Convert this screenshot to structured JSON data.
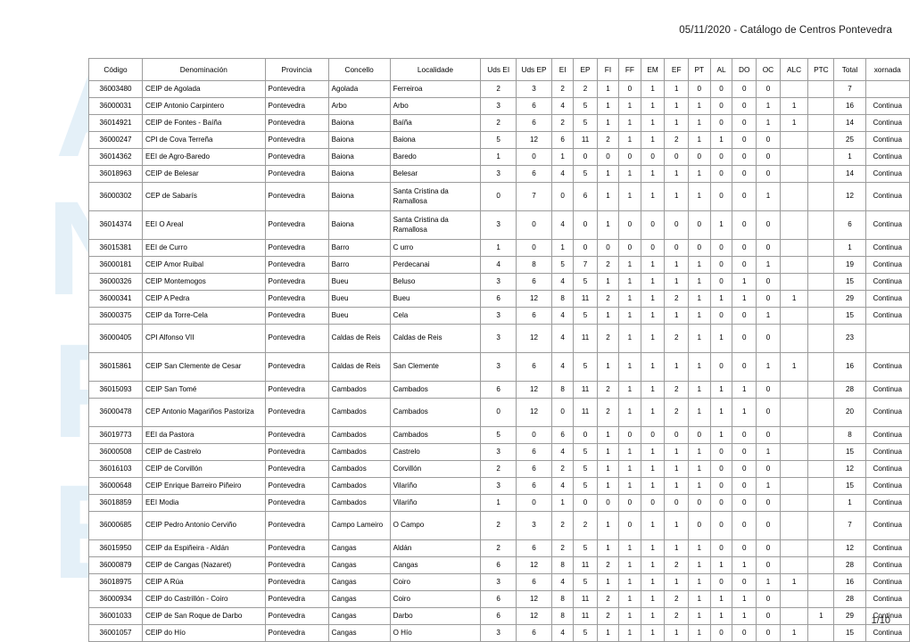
{
  "document": {
    "header": "05/11/2020 - Catálogo de Centros Pontevedra",
    "footer": "1/10",
    "watermark_text": "ANPE",
    "watermark_color": "#cfe4f4",
    "accent_green": "#ccd9ac",
    "accent_yellow": "#ffff00",
    "header_fill": "#d9d9d9"
  },
  "table": {
    "columns": [
      "Código",
      "Denominación",
      "Provincia",
      "Concello",
      "Localidade",
      "Uds EI",
      "Uds EP",
      "EI",
      "EP",
      "FI",
      "FF",
      "EM",
      "EF",
      "PT",
      "AL",
      "DO",
      "OC",
      "ALC",
      "PTC",
      "Total",
      "xornada"
    ],
    "rows": [
      {
        "codigo": "36003480",
        "denominacion": "CEIP de Agolada",
        "provincia": "Pontevedra",
        "concello": "Agolada",
        "localidade": "Ferreiroa",
        "uds_ei": "2",
        "uds_ep": "3",
        "ei": "2",
        "ep": "2",
        "fi": "1",
        "ff": "0",
        "em": "1",
        "ef": "1",
        "pt": "0",
        "al": "0",
        "do": "0",
        "oc": "0",
        "alc": "",
        "ptc": "",
        "total": "7",
        "xornada": "",
        "tall": false
      },
      {
        "codigo": "36000031",
        "denominacion": "CEIP Antonio Carpintero",
        "provincia": "Pontevedra",
        "concello": "Arbo",
        "localidade": "Arbo",
        "uds_ei": "3",
        "uds_ep": "6",
        "ei": "4",
        "ep": "5",
        "fi": "1",
        "ff": "1",
        "em": "1",
        "ef": "1",
        "pt": "1",
        "al": "0",
        "do": "0",
        "oc": "1",
        "alc": "1",
        "ptc": "",
        "total": "16",
        "xornada": "Continua",
        "tall": false
      },
      {
        "codigo": "36014921",
        "denominacion": "CEIP de Fontes - Baíña",
        "provincia": "Pontevedra",
        "concello": "Baiona",
        "localidade": "Baíña",
        "uds_ei": "2",
        "uds_ep": "6",
        "ei": "2",
        "ep": "5",
        "fi": "1",
        "ff": "1",
        "em": "1",
        "ef": "1",
        "pt": "1",
        "al": "0",
        "do": "0",
        "oc": "1",
        "alc": "1",
        "ptc": "",
        "total": "14",
        "xornada": "Continua",
        "tall": false
      },
      {
        "codigo": "36000247",
        "denominacion": "CPI de Cova Terreña",
        "provincia": "Pontevedra",
        "concello": "Baiona",
        "localidade": "Baiona",
        "uds_ei": "5",
        "uds_ep": "12",
        "ei": "6",
        "ep": "11",
        "fi": "2",
        "ff": "1",
        "em": "1",
        "ef": "2",
        "pt": "1",
        "al": "1",
        "do": "0",
        "oc": "0",
        "alc": "",
        "ptc": "",
        "total": "25",
        "xornada": "Continua",
        "tall": false
      },
      {
        "codigo": "36014362",
        "denominacion": "EEI de Agro-Baredo",
        "provincia": "Pontevedra",
        "concello": "Baiona",
        "localidade": "Baredo",
        "uds_ei": "1",
        "uds_ep": "0",
        "ei": "1",
        "ep": "0",
        "fi": "0",
        "ff": "0",
        "em": "0",
        "ef": "0",
        "pt": "0",
        "al": "0",
        "do": "0",
        "oc": "0",
        "alc": "",
        "ptc": "",
        "total": "1",
        "xornada": "Continua",
        "tall": false
      },
      {
        "codigo": "36018963",
        "denominacion": "CEIP de Belesar",
        "provincia": "Pontevedra",
        "concello": "Baiona",
        "localidade": "Belesar",
        "uds_ei": "3",
        "uds_ep": "6",
        "ei": "4",
        "ep": "5",
        "fi": "1",
        "ff": "1",
        "em": "1",
        "ef": "1",
        "pt": "1",
        "al": "0",
        "do": "0",
        "oc": "0",
        "alc": "",
        "ptc": "",
        "total": "14",
        "xornada": "Continua",
        "tall": false
      },
      {
        "codigo": "36000302",
        "denominacion": "CEP de Sabarís",
        "provincia": "Pontevedra",
        "concello": "Baiona",
        "localidade": "Santa Cristina da Ramallosa",
        "uds_ei": "0",
        "uds_ep": "7",
        "ei": "0",
        "ep": "6",
        "fi": "1",
        "ff": "1",
        "em": "1",
        "ef": "1",
        "pt": "1",
        "al": "0",
        "do": "0",
        "oc": "1",
        "alc": "",
        "ptc": "",
        "total": "12",
        "xornada": "Continua",
        "tall": true
      },
      {
        "codigo": "36014374",
        "denominacion": "EEI O Areal",
        "provincia": "Pontevedra",
        "concello": "Baiona",
        "localidade": "Santa Cristina da Ramallosa",
        "uds_ei": "3",
        "uds_ep": "0",
        "ei": "4",
        "ep": "0",
        "fi": "1",
        "ff": "0",
        "em": "0",
        "ef": "0",
        "pt": "0",
        "al": "1",
        "do": "0",
        "oc": "0",
        "alc": "",
        "ptc": "",
        "total": "6",
        "xornada": "Continua",
        "tall": true
      },
      {
        "codigo": "36015381",
        "denominacion": "EEI de Curro",
        "provincia": "Pontevedra",
        "concello": "Barro",
        "localidade": "C urro",
        "uds_ei": "1",
        "uds_ep": "0",
        "ei": "1",
        "ep": "0",
        "fi": "0",
        "ff": "0",
        "em": "0",
        "ef": "0",
        "pt": "0",
        "al": "0",
        "do": "0",
        "oc": "0",
        "alc": "",
        "ptc": "",
        "total": "1",
        "xornada": "Continua",
        "tall": false
      },
      {
        "codigo": "36000181",
        "denominacion": "CEIP Amor Ruibal",
        "provincia": "Pontevedra",
        "concello": "Barro",
        "localidade": "Perdecanai",
        "uds_ei": "4",
        "uds_ep": "8",
        "ei": "5",
        "ep": "7",
        "fi": "2",
        "ff": "1",
        "em": "1",
        "ef": "1",
        "pt": "1",
        "al": "0",
        "do": "0",
        "oc": "1",
        "alc": "",
        "ptc": "",
        "total": "19",
        "xornada": "Continua",
        "tall": false
      },
      {
        "codigo": "36000326",
        "denominacion": "CEIP Montemogos",
        "provincia": "Pontevedra",
        "concello": "Bueu",
        "localidade": "Beluso",
        "uds_ei": "3",
        "uds_ep": "6",
        "ei": "4",
        "ep": "5",
        "fi": "1",
        "ff": "1",
        "em": "1",
        "ef": "1",
        "pt": "1",
        "al": "0",
        "do": "1",
        "oc": "0",
        "alc": "",
        "ptc": "",
        "total": "15",
        "xornada": "Continua",
        "tall": false
      },
      {
        "codigo": "36000341",
        "denominacion": "CEIP A Pedra",
        "provincia": "Pontevedra",
        "concello": "Bueu",
        "localidade": "Bueu",
        "uds_ei": "6",
        "uds_ep": "12",
        "ei": "8",
        "ep": "11",
        "fi": "2",
        "ff": "1",
        "em": "1",
        "ef": "2",
        "pt": "1",
        "al": "1",
        "do": "1",
        "oc": "0",
        "alc": "1",
        "ptc": "",
        "total": "29",
        "xornada": "Continua",
        "tall": false
      },
      {
        "codigo": "36000375",
        "denominacion": "CEIP da Torre-Cela",
        "provincia": "Pontevedra",
        "concello": "Bueu",
        "localidade": "Cela",
        "uds_ei": "3",
        "uds_ep": "6",
        "ei": "4",
        "ep": "5",
        "fi": "1",
        "ff": "1",
        "em": "1",
        "ef": "1",
        "pt": "1",
        "al": "0",
        "do": "0",
        "oc": "1",
        "alc": "",
        "ptc": "",
        "total": "15",
        "xornada": "Continua",
        "tall": false
      },
      {
        "codigo": "36000405",
        "denominacion": "CPI Alfonso VII",
        "provincia": "Pontevedra",
        "concello": "Caldas de Reis",
        "localidade": "Caldas de Reis",
        "uds_ei": "3",
        "uds_ep": "12",
        "ei": "4",
        "ep": "11",
        "fi": "2",
        "ff": "1",
        "em": "1",
        "ef": "2",
        "pt": "1",
        "al": "1",
        "do": "0",
        "oc": "0",
        "alc": "",
        "ptc": "",
        "total": "23",
        "xornada": "",
        "tall": true
      },
      {
        "codigo": "36015861",
        "denominacion": "CEIP San Clemente de Cesar",
        "provincia": "Pontevedra",
        "concello": "Caldas de Reis",
        "localidade": "San Clemente",
        "uds_ei": "3",
        "uds_ep": "6",
        "ei": "4",
        "ep": "5",
        "fi": "1",
        "ff": "1",
        "em": "1",
        "ef": "1",
        "pt": "1",
        "al": "0",
        "do": "0",
        "oc": "1",
        "alc": "1",
        "ptc": "",
        "total": "16",
        "xornada": "Continua",
        "tall": true
      },
      {
        "codigo": "36015093",
        "denominacion": "CEIP San Tomé",
        "provincia": "Pontevedra",
        "concello": "Cambados",
        "localidade": "Cambados",
        "uds_ei": "6",
        "uds_ep": "12",
        "ei": "8",
        "ep": "11",
        "fi": "2",
        "ff": "1",
        "em": "1",
        "ef": "2",
        "pt": "1",
        "al": "1",
        "do": "1",
        "oc": "0",
        "alc": "",
        "ptc": "",
        "total": "28",
        "xornada": "Continua",
        "tall": false
      },
      {
        "codigo": "36000478",
        "denominacion": "CEP Antonio Magariños Pastoriza",
        "provincia": "Pontevedra",
        "concello": "Cambados",
        "localidade": "Cambados",
        "uds_ei": "0",
        "uds_ep": "12",
        "ei": "0",
        "ep": "11",
        "fi": "2",
        "ff": "1",
        "em": "1",
        "ef": "2",
        "pt": "1",
        "al": "1",
        "do": "1",
        "oc": "0",
        "alc": "",
        "ptc": "",
        "total": "20",
        "xornada": "Continua",
        "tall": true
      },
      {
        "codigo": "36019773",
        "denominacion": "EEI da Pastora",
        "provincia": "Pontevedra",
        "concello": "Cambados",
        "localidade": "Cambados",
        "uds_ei": "5",
        "uds_ep": "0",
        "ei": "6",
        "ep": "0",
        "fi": "1",
        "ff": "0",
        "em": "0",
        "ef": "0",
        "pt": "0",
        "al": "1",
        "do": "0",
        "oc": "0",
        "alc": "",
        "ptc": "",
        "total": "8",
        "xornada": "Continua",
        "tall": false
      },
      {
        "codigo": "36000508",
        "denominacion": "CEIP de Castrelo",
        "provincia": "Pontevedra",
        "concello": "Cambados",
        "localidade": "Castrelo",
        "uds_ei": "3",
        "uds_ep": "6",
        "ei": "4",
        "ep": "5",
        "fi": "1",
        "ff": "1",
        "em": "1",
        "ef": "1",
        "pt": "1",
        "al": "0",
        "do": "0",
        "oc": "1",
        "alc": "",
        "ptc": "",
        "total": "15",
        "xornada": "Continua",
        "tall": false
      },
      {
        "codigo": "36016103",
        "denominacion": "CEIP de Corvillón",
        "provincia": "Pontevedra",
        "concello": "Cambados",
        "localidade": "Corvillón",
        "uds_ei": "2",
        "uds_ep": "6",
        "ei": "2",
        "ep": "5",
        "fi": "1",
        "ff": "1",
        "em": "1",
        "ef": "1",
        "pt": "1",
        "al": "0",
        "do": "0",
        "oc": "0",
        "alc": "",
        "ptc": "",
        "total": "12",
        "xornada": "Continua",
        "tall": false
      },
      {
        "codigo": "36000648",
        "denominacion": "CEIP Enrique Barreiro Piñeiro",
        "provincia": "Pontevedra",
        "concello": "Cambados",
        "localidade": "Vilariño",
        "uds_ei": "3",
        "uds_ep": "6",
        "ei": "4",
        "ep": "5",
        "fi": "1",
        "ff": "1",
        "em": "1",
        "ef": "1",
        "pt": "1",
        "al": "0",
        "do": "0",
        "oc": "1",
        "alc": "",
        "ptc": "",
        "total": "15",
        "xornada": "Continua",
        "tall": false
      },
      {
        "codigo": "36018859",
        "denominacion": "EEI Modia",
        "provincia": "Pontevedra",
        "concello": "Cambados",
        "localidade": "Vilariño",
        "uds_ei": "1",
        "uds_ep": "0",
        "ei": "1",
        "ep": "0",
        "fi": "0",
        "ff": "0",
        "em": "0",
        "ef": "0",
        "pt": "0",
        "al": "0",
        "do": "0",
        "oc": "0",
        "alc": "",
        "ptc": "",
        "total": "1",
        "xornada": "Continua",
        "tall": false
      },
      {
        "codigo": "36000685",
        "denominacion": "CEIP Pedro Antonio Cerviño",
        "provincia": "Pontevedra",
        "concello": "Campo Lameiro",
        "localidade": "O Campo",
        "uds_ei": "2",
        "uds_ep": "3",
        "ei": "2",
        "ep": "2",
        "fi": "1",
        "ff": "0",
        "em": "1",
        "ef": "1",
        "pt": "0",
        "al": "0",
        "do": "0",
        "oc": "0",
        "alc": "",
        "ptc": "",
        "total": "7",
        "xornada": "Continua",
        "tall": true
      },
      {
        "codigo": "36015950",
        "denominacion": "CEIP da Espiñeira - Aldán",
        "provincia": "Pontevedra",
        "concello": "Cangas",
        "localidade": "Aldán",
        "uds_ei": "2",
        "uds_ep": "6",
        "ei": "2",
        "ep": "5",
        "fi": "1",
        "ff": "1",
        "em": "1",
        "ef": "1",
        "pt": "1",
        "al": "0",
        "do": "0",
        "oc": "0",
        "alc": "",
        "ptc": "",
        "total": "12",
        "xornada": "Continua",
        "tall": false
      },
      {
        "codigo": "36000879",
        "denominacion": "CEIP de Cangas (Nazaret)",
        "provincia": "Pontevedra",
        "concello": "Cangas",
        "localidade": "Cangas",
        "uds_ei": "6",
        "uds_ep": "12",
        "ei": "8",
        "ep": "11",
        "fi": "2",
        "ff": "1",
        "em": "1",
        "ef": "2",
        "pt": "1",
        "al": "1",
        "do": "1",
        "oc": "0",
        "alc": "",
        "ptc": "",
        "total": "28",
        "xornada": "Continua",
        "tall": false
      },
      {
        "codigo": "36018975",
        "denominacion": "CEIP A Rúa",
        "provincia": "Pontevedra",
        "concello": "Cangas",
        "localidade": "Coiro",
        "uds_ei": "3",
        "uds_ep": "6",
        "ei": "4",
        "ep": "5",
        "fi": "1",
        "ff": "1",
        "em": "1",
        "ef": "1",
        "pt": "1",
        "al": "0",
        "do": "0",
        "oc": "1",
        "alc": "1",
        "ptc": "",
        "total": "16",
        "xornada": "Continua",
        "tall": false
      },
      {
        "codigo": "36000934",
        "denominacion": "CEIP do Castrillón - Coiro",
        "provincia": "Pontevedra",
        "concello": "Cangas",
        "localidade": "Coiro",
        "uds_ei": "6",
        "uds_ep": "12",
        "ei": "8",
        "ep": "11",
        "fi": "2",
        "ff": "1",
        "em": "1",
        "ef": "2",
        "pt": "1",
        "al": "1",
        "do": "1",
        "oc": "0",
        "alc": "",
        "ptc": "",
        "total": "28",
        "xornada": "Continua",
        "tall": false
      },
      {
        "codigo": "36001033",
        "denominacion": "CEIP de San Roque de Darbo",
        "provincia": "Pontevedra",
        "concello": "Cangas",
        "localidade": "Darbo",
        "uds_ei": "6",
        "uds_ep": "12",
        "ei": "8",
        "ep": "11",
        "fi": "2",
        "ff": "1",
        "em": "1",
        "ef": "2",
        "pt": "1",
        "al": "1",
        "do": "1",
        "oc": "0",
        "alc": "",
        "ptc": "1",
        "total": "29",
        "xornada": "Continua",
        "tall": false
      },
      {
        "codigo": "36001057",
        "denominacion": "CEIP do Hío",
        "provincia": "Pontevedra",
        "concello": "Cangas",
        "localidade": "O Hío",
        "uds_ei": "3",
        "uds_ep": "6",
        "ei": "4",
        "ep": "5",
        "fi": "1",
        "ff": "1",
        "em": "1",
        "ef": "1",
        "pt": "1",
        "al": "0",
        "do": "0",
        "oc": "0",
        "alc": "1",
        "ptc": "",
        "total": "15",
        "xornada": "Continua",
        "tall": false
      }
    ]
  }
}
